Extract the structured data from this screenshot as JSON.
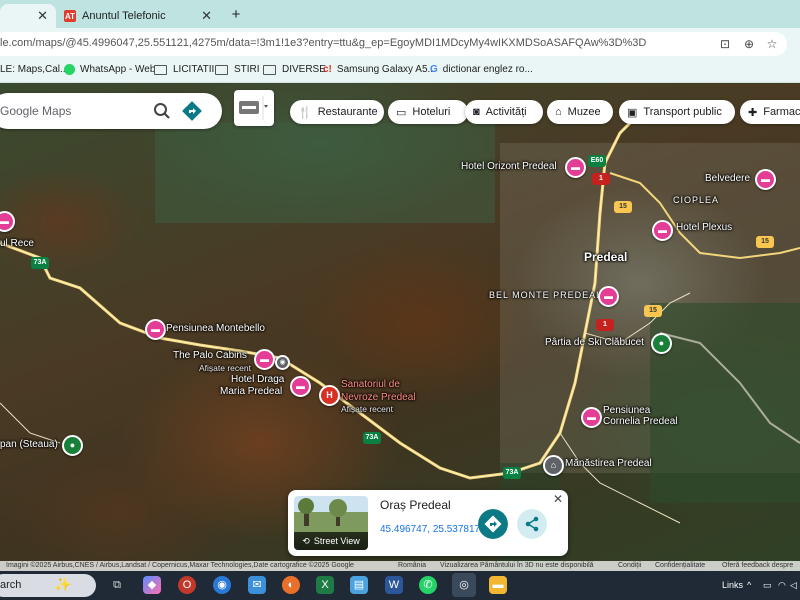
{
  "browser": {
    "tabs": [
      {
        "label": "",
        "active": true
      },
      {
        "label": "Anuntul Telefonic",
        "favicon_text": "AT",
        "active": false
      }
    ],
    "url": "le.com/maps/@45.4996047,25.551121,4275m/data=!3m1!1e3?entry=ttu&g_ep=EgoyMDI1MDcyMy4wIKXMDSoASAFQAw%3D%3D",
    "bookmarks": [
      {
        "label": "LE: Maps,Cal...",
        "icon": "google-icon"
      },
      {
        "label": "WhatsApp - Web",
        "icon": "whatsapp-icon"
      },
      {
        "label": "LICITATII",
        "icon": "folder-icon"
      },
      {
        "label": "STIRI",
        "icon": "folder-icon"
      },
      {
        "label": "DIVERSE",
        "icon": "folder-icon"
      },
      {
        "label": "Samsung Galaxy A5...",
        "icon": "c-icon"
      },
      {
        "label": "dictionar englez ro...",
        "icon": "google-icon"
      }
    ]
  },
  "maps": {
    "search_placeholder": "Google Maps",
    "chips": [
      {
        "label": "Restaurante",
        "icon": "fork-knife-icon"
      },
      {
        "label": "Hoteluri",
        "icon": "bed-icon"
      },
      {
        "label": "Activități",
        "icon": "camera-icon"
      },
      {
        "label": "Muzee",
        "icon": "museum-icon"
      },
      {
        "label": "Transport public",
        "icon": "bus-icon"
      },
      {
        "label": "Farmac",
        "icon": "pharmacy-icon"
      }
    ],
    "places": {
      "hotel_orizont": "Hotel Orizont Predeal",
      "belvedere": "Belvedere",
      "cioplea": "CIOPLEA",
      "hotel_plexus": "Hotel Plexus",
      "predeal": "Predeal",
      "bel_monte": "BEL MONTE PREDEAL",
      "partia": "Pârtia de Ski Clăbucet",
      "montebello": "Pensiunea Montebello",
      "palo_cabins": "The Palo Cabins",
      "palo_recent": "Afișate recent",
      "hotel_draga_1": "Hotel Draga",
      "hotel_draga_2": "Maria Predeal",
      "sanatoriul_1": "Sanatoriul de",
      "sanatoriul_2": "Nevroze Predeal",
      "sanatoriul_recent": "Afișate recent",
      "pensiunea_cornelia_1": "Pensiunea",
      "pensiunea_cornelia_2": "Cornelia Predeal",
      "manastirea": "Mănăstirea Predeal",
      "ul_rece": "ul Rece",
      "steaua": "pan (Steaua)"
    },
    "road_shields": {
      "r73a_1": "73A",
      "r73a_2": "73A",
      "r73a_3": "73A",
      "e60": "E60",
      "n1_a": "1",
      "n1_b": "1",
      "n15_a": "15",
      "n15_b": "15",
      "n15_c": "15"
    },
    "card": {
      "title": "Oraș Predeal",
      "coordinates": "45.496747, 25.537817",
      "street_view_label": "Street View"
    },
    "attribution": {
      "imagery": "Imagini ©2025 Airbus,CNES / Airbus,Landsat / Copernicus,Maxar Technologies,Date cartografice ©2025 Google",
      "country": "România",
      "view3d": "Vizualizarea Pământului în 3D nu este disponibilă",
      "terms": "Condiții",
      "privacy": "Confidențialitate",
      "feedback": "Oferă feedback despre"
    }
  },
  "taskbar": {
    "search_label": "arch",
    "links_label": "Links"
  },
  "colors": {
    "chrome_tab_bar": "#bfe3e1",
    "hotel_pin": "#e33d95",
    "park_pin": "#188038",
    "teal_button": "#0b7a84"
  }
}
